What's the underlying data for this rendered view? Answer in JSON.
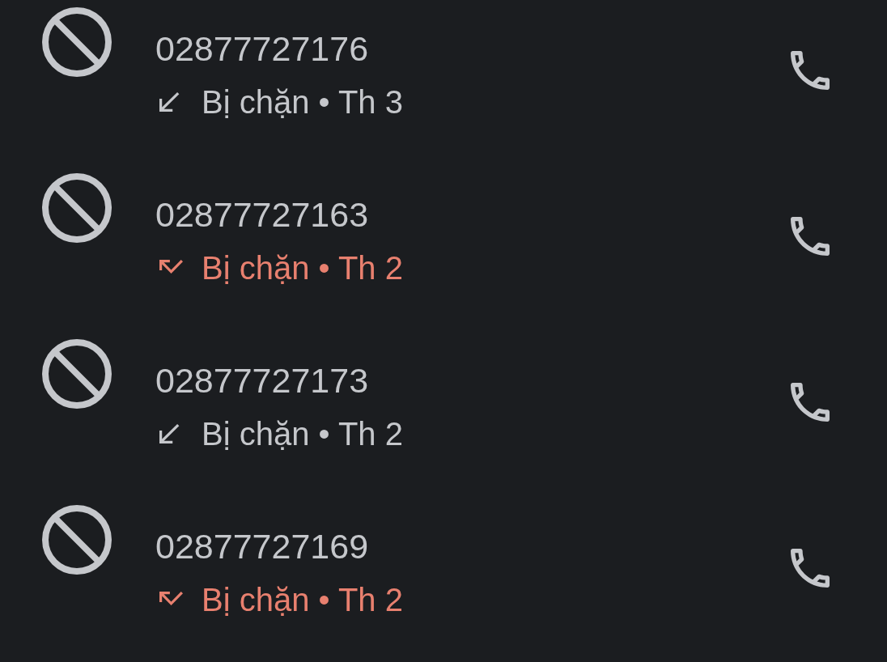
{
  "calls": [
    {
      "number": "02877727176",
      "missed": false,
      "detail": "Bị chặn • Th 3"
    },
    {
      "number": "02877727163",
      "missed": true,
      "detail": "Bị chặn • Th 2"
    },
    {
      "number": "02877727173",
      "missed": false,
      "detail": "Bị chặn • Th 2"
    },
    {
      "number": "02877727169",
      "missed": true,
      "detail": "Bị chặn • Th 2"
    }
  ]
}
